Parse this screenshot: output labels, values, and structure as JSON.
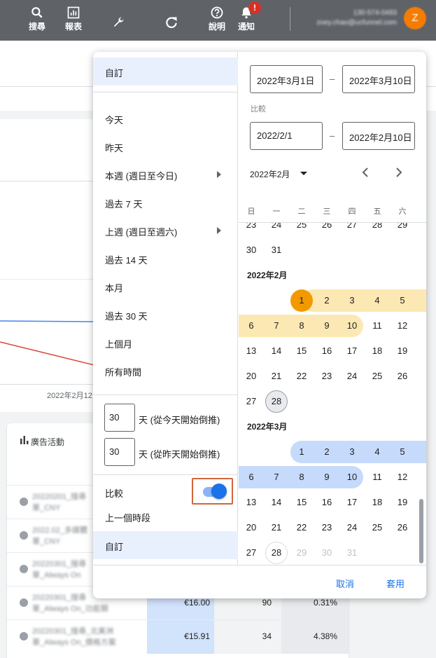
{
  "topbar": {
    "items": [
      {
        "label": "搜尋",
        "icon": "search-icon"
      },
      {
        "label": "報表",
        "icon": "reports-icon"
      },
      {
        "label": "工具與\n設定",
        "icon": "tools-icon"
      },
      {
        "label": "重新整\n理",
        "icon": "refresh-icon"
      },
      {
        "label": "說明",
        "icon": "help-icon"
      },
      {
        "label": "通知",
        "icon": "bell-icon"
      }
    ],
    "notif_badge": "!",
    "account_phone": "130-574-0493",
    "account_email": "zoey.chao@ucfunnel.com",
    "avatar_letter": "Z"
  },
  "background": {
    "date_tick": "2022年2月12",
    "table_title": "廣告活動",
    "rows": [
      {
        "name": "20220201_搜尋\n單_CNY",
        "v1": "",
        "v2": "",
        "v3": ""
      },
      {
        "name": "2022.02_多媒體\n單_CNY",
        "v1": "",
        "v2": "",
        "v3": ""
      },
      {
        "name": "20220301_搜尋\n單_Always On",
        "v1": "",
        "v2": "",
        "v3": ""
      },
      {
        "name": "20220301_搜尋\n單_Always On_功能類",
        "v1": "€16.00",
        "v2": "90",
        "v3": "0.31%"
      },
      {
        "name": "20220301_搜尋_北美洲\n單_Always On_價格方案",
        "v1": "€15.91",
        "v2": "34",
        "v3": "4.38%"
      }
    ]
  },
  "popup": {
    "options": [
      {
        "label": "自訂",
        "selected": true
      },
      {
        "label": "今天"
      },
      {
        "label": "昨天"
      },
      {
        "label": "本週 (週日至今日)",
        "submenu": true
      },
      {
        "label": "過去 7 天"
      },
      {
        "label": "上週 (週日至週六)",
        "submenu": true
      },
      {
        "label": "過去 14 天"
      },
      {
        "label": "本月"
      },
      {
        "label": "過去 30 天"
      },
      {
        "label": "上個月"
      },
      {
        "label": "所有時間"
      }
    ],
    "days_from_today": {
      "value": "30",
      "label": "天 (從今天開始倒推)"
    },
    "days_from_yesterday": {
      "value": "30",
      "label": "天 (從昨天開始倒推)"
    },
    "compare": {
      "label": "比較",
      "enabled": true
    },
    "compare_options": [
      {
        "label": "上一個時段"
      },
      {
        "label": "自訂",
        "selected": true
      }
    ],
    "range": {
      "start": "2022年3月1日",
      "end": "2022年3月10日"
    },
    "compare_caption": "比較",
    "compare_range": {
      "start": "2022/2/1",
      "end": "2022年2月10日"
    },
    "month_selector": "2022年2月",
    "weekdays": [
      "日",
      "一",
      "二",
      "三",
      "四",
      "五",
      "六"
    ],
    "calendar": {
      "jan_tail": [
        [
          "23",
          "24",
          "25",
          "26",
          "27",
          "28",
          "29"
        ],
        [
          "30",
          "31"
        ]
      ],
      "feb_label": "2022年2月",
      "feb": [
        [
          "",
          "",
          "1",
          "2",
          "3",
          "4",
          "5"
        ],
        [
          "6",
          "7",
          "8",
          "9",
          "10",
          "11",
          "12"
        ],
        [
          "13",
          "14",
          "15",
          "16",
          "17",
          "18",
          "19"
        ],
        [
          "20",
          "21",
          "22",
          "23",
          "24",
          "25",
          "26"
        ],
        [
          "27",
          "28"
        ]
      ],
      "mar_label": "2022年3月",
      "mar": [
        [
          "",
          "",
          "1",
          "2",
          "3",
          "4",
          "5"
        ],
        [
          "6",
          "7",
          "8",
          "9",
          "10",
          "11",
          "12"
        ],
        [
          "13",
          "14",
          "15",
          "16",
          "17",
          "18",
          "19"
        ],
        [
          "20",
          "21",
          "22",
          "23",
          "24",
          "25",
          "26"
        ],
        [
          "27",
          "28",
          "29",
          "30",
          "31"
        ]
      ]
    },
    "cancel_label": "取消",
    "apply_label": "套用"
  },
  "colors": {
    "topbar": "#5f6368",
    "accent": "#1a73e8",
    "compare_range": "#fce8b2",
    "primary_range": "#c6dafc",
    "today_marker": "#f29900"
  }
}
